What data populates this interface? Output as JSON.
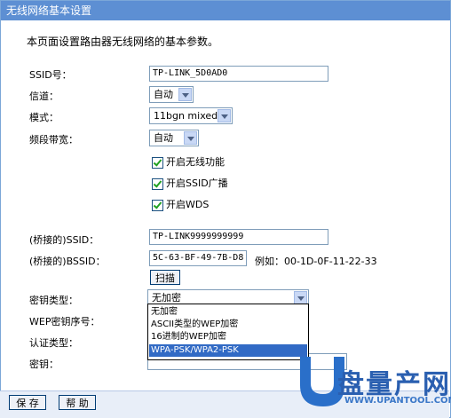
{
  "window": {
    "title": "无线网络基本设置"
  },
  "description": "本页面设置路由器无线网络的基本参数。",
  "fields": {
    "ssid": {
      "label": "SSID号：",
      "value": "TP-LINK_5D0AD0"
    },
    "channel": {
      "label": "信道：",
      "value": "自动"
    },
    "mode": {
      "label": "模式：",
      "value": "11bgn mixed"
    },
    "bandwidth": {
      "label": "频段带宽：",
      "value": "自动"
    }
  },
  "checkboxes": [
    {
      "label": "开启无线功能",
      "checked": true
    },
    {
      "label": "开启SSID广播",
      "checked": true
    },
    {
      "label": "开启WDS",
      "checked": true
    }
  ],
  "bridge": {
    "ssid_label": "(桥接的)SSID：",
    "ssid_value": "TP-LINK9999999999",
    "bssid_label": "(桥接的)BSSID：",
    "bssid_value": "5C-63-BF-49-7B-D8",
    "bssid_example": "例如：00-1D-0F-11-22-33",
    "scan_label": "扫描"
  },
  "security": {
    "key_type_label": "密钥类型：",
    "key_type_value": "无加密",
    "wep_index_label": "WEP密钥序号：",
    "auth_type_label": "认证类型：",
    "key_label": "密钥：",
    "options": [
      "无加密",
      "ASCII类型的WEP加密",
      "16进制的WEP加密",
      "WPA-PSK/WPA2-PSK"
    ],
    "highlighted_option": "WPA-PSK/WPA2-PSK"
  },
  "buttons": {
    "save": "保 存",
    "help": "帮 助"
  },
  "watermark": {
    "brand": "盘量产网",
    "url": "WWW.UPANTOOL.COM"
  },
  "colors": {
    "titlebar": "#5d8fd3",
    "highlight": "#316ac5",
    "check": "#21a121"
  }
}
